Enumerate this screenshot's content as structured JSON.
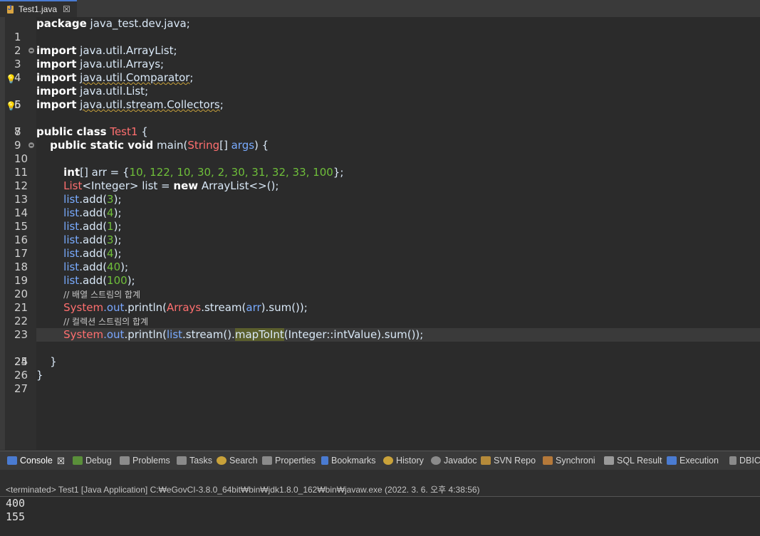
{
  "editor_tab": {
    "title": "Test1.java",
    "close": "☒"
  },
  "code_lines": [
    {
      "n": "1"
    },
    {
      "n": "2"
    },
    {
      "n": "3"
    },
    {
      "n": "4"
    },
    {
      "n": "5"
    },
    {
      "n": "6"
    },
    {
      "n": "7"
    },
    {
      "n": "8"
    },
    {
      "n": "9"
    },
    {
      "n": "10"
    },
    {
      "n": "11"
    },
    {
      "n": "12"
    },
    {
      "n": "13"
    },
    {
      "n": "14"
    },
    {
      "n": "15"
    },
    {
      "n": "16"
    },
    {
      "n": "17"
    },
    {
      "n": "18"
    },
    {
      "n": "19"
    },
    {
      "n": "20"
    },
    {
      "n": "21"
    },
    {
      "n": "22"
    },
    {
      "n": "23"
    },
    {
      "n": "24"
    },
    {
      "n": "25"
    },
    {
      "n": "26"
    },
    {
      "n": "27"
    }
  ],
  "code": {
    "l1_kw": "package",
    "l1_rest": " java_test.dev.java;",
    "l3_kw": "import",
    "l3_rest": " java.util.ArrayList;",
    "l4_kw": "import",
    "l4_rest": " java.util.Arrays;",
    "l5_kw": "import",
    "l5_rest": "java.util.Comparator",
    "l6_kw": "import",
    "l6_rest": " java.util.List;",
    "l7_kw": "import",
    "l7_rest": "java.util.stream.Collectors",
    "l9_kw": "public class",
    "l9_cls": "Test1",
    "l9_rest": " {",
    "l10_kw": "public static void",
    "l10_m": " main(",
    "l10_cls": "String",
    "l10_b": "[] ",
    "l10_arg": "args",
    "l10_end": ") {",
    "l12_kw": "int",
    "l12_a": "[] arr = {",
    "l12_nums": "10, 122, 10, 30, 2, 30, 31, 32, 33, 100",
    "l12_end": "};",
    "l13_cls": "List",
    "l13_a": "<Integer> list = ",
    "l13_kw": "new",
    "l13_end": " ArrayList<>();",
    "add_calls": [
      {
        "obj": "list",
        "m": ".add(",
        "v": "3",
        "e": ");"
      },
      {
        "obj": "list",
        "m": ".add(",
        "v": "4",
        "e": ");"
      },
      {
        "obj": "list",
        "m": ".add(",
        "v": "1",
        "e": ");"
      },
      {
        "obj": "list",
        "m": ".add(",
        "v": "3",
        "e": ");"
      },
      {
        "obj": "list",
        "m": ".add(",
        "v": "4",
        "e": ");"
      },
      {
        "obj": "list",
        "m": ".add(",
        "v": "40",
        "e": ");"
      },
      {
        "obj": "list",
        "m": ".add(",
        "v": "100",
        "e": ");"
      }
    ],
    "l21_cmt": "// 배열 스트림의 합계",
    "l22_cls": "System",
    "l22_fld": ".out",
    "l22_a": ".println(",
    "l22_cls2": "Arrays",
    "l22_b": ".stream(",
    "l22_arr": "arr",
    "l22_end": ").sum());",
    "l23_cmt": "// 컬렉션 스트림의 합계",
    "l24_cls": "System",
    "l24_fld": ".out",
    "l24_a": ".println(",
    "l24_list": "list",
    "l24_b": ".stream().",
    "l24_occ": "mapToInt",
    "l24_c": "(Integer::intValue)",
    "l24_d": ".sum());",
    "l26": "    }",
    "l27": "}"
  },
  "console_tabs": [
    {
      "label": "Console",
      "icon": "console-icon",
      "close": "☒"
    },
    {
      "label": "Debug",
      "icon": "bug-icon"
    },
    {
      "label": "Problems",
      "icon": "problems-icon"
    },
    {
      "label": "Tasks",
      "icon": "tasks-icon"
    },
    {
      "label": "Search",
      "icon": "search-icon"
    },
    {
      "label": "Properties",
      "icon": "properties-icon"
    },
    {
      "label": "Bookmarks",
      "icon": "bookmark-icon"
    },
    {
      "label": "History",
      "icon": "history-icon"
    },
    {
      "label": "Javadoc",
      "icon": "javadoc-icon"
    },
    {
      "label": "SVN Repo",
      "icon": "svn-icon"
    },
    {
      "label": "Synchroni",
      "icon": "sync-icon"
    },
    {
      "label": "SQL Result",
      "icon": "sql-result-icon"
    },
    {
      "label": "Execution",
      "icon": "execution-icon"
    },
    {
      "label": "DBIC",
      "icon": "dbic-icon"
    }
  ],
  "console": {
    "status": "<terminated> Test1 [Java Application] C:₩eGovCI-3.8.0_64bit₩bin₩jdk1.8.0_162₩bin₩javaw.exe  (2022. 3. 6. 오후 4:38:56)",
    "output": [
      "400",
      "155"
    ]
  },
  "colors": {
    "keyword": "#ffffff",
    "class": "#ff6f6f",
    "number": "#6fbf3a",
    "field": "#7aa7ff",
    "background": "#2b2b2b"
  }
}
